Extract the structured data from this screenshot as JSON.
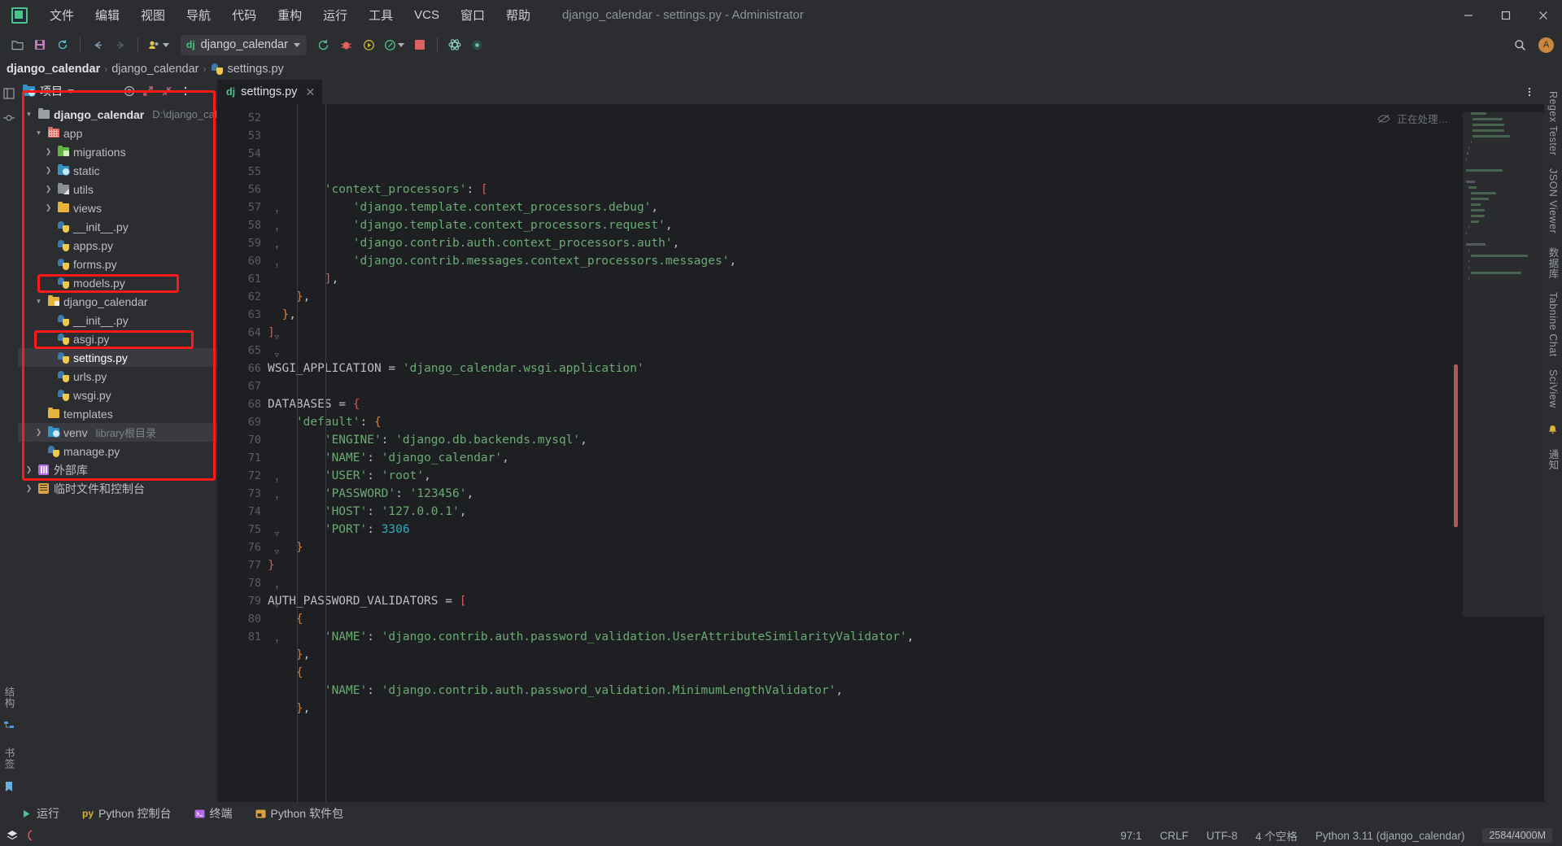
{
  "titlebar": {
    "menu": [
      "文件",
      "编辑",
      "视图",
      "导航",
      "代码",
      "重构",
      "运行",
      "工具",
      "VCS",
      "窗口",
      "帮助"
    ],
    "window_title": "django_calendar - settings.py - Administrator",
    "minimize": "—",
    "maximize": "▢",
    "close": "✕"
  },
  "toolbar": {
    "run_config_name": "django_calendar",
    "dj_badge": "dj",
    "avatar_initial": "A"
  },
  "breadcrumb": {
    "root": "django_calendar",
    "sep": "›",
    "mid": "django_calendar",
    "file": "settings.py"
  },
  "left_strip": {
    "labels": [
      "结构",
      "书签"
    ]
  },
  "project_panel": {
    "title": "项目",
    "tree": [
      {
        "indent": 0,
        "arrow": "down",
        "icon": "folder-gray",
        "label": "django_calendar",
        "bold": true,
        "sub": "D:\\django_calendar"
      },
      {
        "indent": 1,
        "arrow": "down",
        "icon": "folder-red",
        "label": "app"
      },
      {
        "indent": 2,
        "arrow": "right",
        "icon": "folder-green",
        "label": "migrations"
      },
      {
        "indent": 2,
        "arrow": "right",
        "icon": "folder-blue",
        "label": "static"
      },
      {
        "indent": 2,
        "arrow": "right",
        "icon": "folder-gray2",
        "label": "utils"
      },
      {
        "indent": 2,
        "arrow": "right",
        "icon": "folder-yellow",
        "label": "views"
      },
      {
        "indent": 2,
        "arrow": "none",
        "icon": "python",
        "label": "__init__.py"
      },
      {
        "indent": 2,
        "arrow": "none",
        "icon": "python",
        "label": "apps.py"
      },
      {
        "indent": 2,
        "arrow": "none",
        "icon": "python",
        "label": "forms.py"
      },
      {
        "indent": 2,
        "arrow": "none",
        "icon": "python",
        "label": "models.py"
      },
      {
        "indent": 1,
        "arrow": "down",
        "icon": "folder-src",
        "label": "django_calendar",
        "annotated": true
      },
      {
        "indent": 2,
        "arrow": "none",
        "icon": "python",
        "label": "__init__.py"
      },
      {
        "indent": 2,
        "arrow": "none",
        "icon": "python",
        "label": "asgi.py"
      },
      {
        "indent": 2,
        "arrow": "none",
        "icon": "python",
        "label": "settings.py",
        "selected": true,
        "white": true,
        "annotated": true
      },
      {
        "indent": 2,
        "arrow": "none",
        "icon": "python",
        "label": "urls.py"
      },
      {
        "indent": 2,
        "arrow": "none",
        "icon": "python",
        "label": "wsgi.py"
      },
      {
        "indent": 1,
        "arrow": "none",
        "icon": "folder-yellow",
        "label": "templates"
      },
      {
        "indent": 1,
        "arrow": "right",
        "icon": "folder-blue",
        "label": "venv",
        "sub": "library根目录",
        "hl": true
      },
      {
        "indent": 1,
        "arrow": "none",
        "icon": "python",
        "label": "manage.py"
      },
      {
        "indent": 0,
        "arrow": "right",
        "icon": "library",
        "label": "外部库"
      },
      {
        "indent": 0,
        "arrow": "right",
        "icon": "scratch",
        "label": "临时文件和控制台"
      }
    ]
  },
  "editor": {
    "tab_label": "settings.py",
    "tab_badge": "dj",
    "tab_close": "✕",
    "inspection_status": "正在处理…",
    "first_line": 52,
    "lines": [
      {
        "n": 52,
        "fold": "",
        "html": "        <span class='s-str'>'context_processors'</span><span class='s-brk'>:</span> <span class='s-brk-r'>[</span>"
      },
      {
        "n": 53,
        "fold": "",
        "html": "            <span class='s-str'>'django.template.context_processors.debug'</span><span class='s-brk'>,</span>"
      },
      {
        "n": 54,
        "fold": "",
        "html": "            <span class='s-str'>'django.template.context_processors.request'</span><span class='s-brk'>,</span>"
      },
      {
        "n": 55,
        "fold": "",
        "html": "            <span class='s-str'>'django.contrib.auth.context_processors.auth'</span><span class='s-brk'>,</span>"
      },
      {
        "n": 56,
        "fold": "",
        "html": "            <span class='s-str'>'django.contrib.messages.context_processors.messages'</span><span class='s-brk'>,</span>"
      },
      {
        "n": 57,
        "fold": "↑",
        "html": "        <span class='s-brk-r'>]</span><span class='s-brk'>,</span>"
      },
      {
        "n": 58,
        "fold": "↑",
        "html": "    <span class='s-brk-o'>}</span><span class='s-brk'>,</span>"
      },
      {
        "n": 59,
        "fold": "↑",
        "html": "  <span class='s-brk-o'>}</span><span class='s-brk'>,</span>"
      },
      {
        "n": 60,
        "fold": "↑",
        "html": "<span class='s-brk-r'>]</span>"
      },
      {
        "n": 61,
        "fold": "",
        "html": ""
      },
      {
        "n": 62,
        "fold": "",
        "html": "<span class='s-ident'>WSGI_APPLICATION</span> <span class='s-brk'>=</span> <span class='s-str'>'django_calendar.wsgi.application'</span>"
      },
      {
        "n": 63,
        "fold": "",
        "html": ""
      },
      {
        "n": 64,
        "fold": "▽",
        "html": "<span class='s-ident'>DATABASES</span> <span class='s-brk'>=</span> <span class='s-brk-r'>{</span>"
      },
      {
        "n": 65,
        "fold": "▽",
        "html": "    <span class='s-str'>'default'</span><span class='s-brk'>:</span> <span class='s-brk-o'>{</span>"
      },
      {
        "n": 66,
        "fold": "",
        "html": "        <span class='s-str'>'ENGINE'</span><span class='s-brk'>:</span> <span class='s-str'>'django.db.backends.mysql'</span><span class='s-brk'>,</span>"
      },
      {
        "n": 67,
        "fold": "",
        "html": "        <span class='s-str'>'NAME'</span><span class='s-brk'>:</span> <span class='s-str'>'django_calendar'</span><span class='s-brk'>,</span>"
      },
      {
        "n": 68,
        "fold": "",
        "html": "        <span class='s-str'>'USER'</span><span class='s-brk'>:</span> <span class='s-str'>'root'</span><span class='s-brk'>,</span>"
      },
      {
        "n": 69,
        "fold": "",
        "html": "        <span class='s-str'>'PASSWORD'</span><span class='s-brk'>:</span> <span class='s-str'>'123456'</span><span class='s-brk'>,</span>"
      },
      {
        "n": 70,
        "fold": "",
        "html": "        <span class='s-str'>'HOST'</span><span class='s-brk'>:</span> <span class='s-str'>'127.0.0.1'</span><span class='s-brk'>,</span>"
      },
      {
        "n": 71,
        "fold": "",
        "html": "        <span class='s-str'>'PORT'</span><span class='s-brk'>:</span> <span class='s-num'>3306</span>"
      },
      {
        "n": 72,
        "fold": "↑",
        "html": "    <span class='s-brk-o'>}</span>"
      },
      {
        "n": 73,
        "fold": "↑",
        "html": "<span class='s-brk-r'>}</span>"
      },
      {
        "n": 74,
        "fold": "",
        "html": ""
      },
      {
        "n": 75,
        "fold": "▽",
        "html": "<span class='s-ident'>AUTH_PASSWORD_VALIDATORS</span> <span class='s-brk'>=</span> <span class='s-brk-r'>[</span>"
      },
      {
        "n": 76,
        "fold": "▽",
        "html": "    <span class='s-brk-o'>{</span>"
      },
      {
        "n": 77,
        "fold": "",
        "html": "        <span class='s-str'>'NAME'</span><span class='s-brk'>:</span> <span class='s-str'>'django.contrib.auth.password_validation.UserAttributeSimilarityValidator'</span><span class='s-brk'>,</span>"
      },
      {
        "n": 78,
        "fold": "↑",
        "html": "    <span class='s-brk-o'>}</span><span class='s-brk'>,</span>"
      },
      {
        "n": 79,
        "fold": "▽",
        "html": "    <span class='s-brk-o'>{</span>"
      },
      {
        "n": 80,
        "fold": "",
        "html": "        <span class='s-str'>'NAME'</span><span class='s-brk'>:</span> <span class='s-str'>'django.contrib.auth.password_validation.MinimumLengthValidator'</span><span class='s-brk'>,</span>"
      },
      {
        "n": 81,
        "fold": "↑",
        "html": "    <span class='s-brk-o'>}</span><span class='s-brk'>,</span>"
      }
    ]
  },
  "right_strip": {
    "labels": [
      "Regex Tester",
      "JSON Viewer",
      "数据库",
      "Tabnine Chat",
      "SciView",
      "通知"
    ]
  },
  "bottom_tabs": [
    {
      "label": "运行",
      "icon": "run-icon"
    },
    {
      "label": "Python 控制台",
      "icon": "python-console-icon"
    },
    {
      "label": "终端",
      "icon": "terminal-icon"
    },
    {
      "label": "Python 软件包",
      "icon": "packages-icon"
    }
  ],
  "statusbar": {
    "caret": "97:1",
    "line_sep": "CRLF",
    "encoding": "UTF-8",
    "indent": "4 个空格",
    "interpreter": "Python 3.11 (django_calendar)",
    "memory": "2584/4000M"
  },
  "colors": {
    "accent_red": "#ff1a1a",
    "editor_bg": "#1e1f22",
    "chrome_bg": "#2b2d30",
    "string_green": "#6aab73",
    "number_blue": "#2aacb8"
  }
}
